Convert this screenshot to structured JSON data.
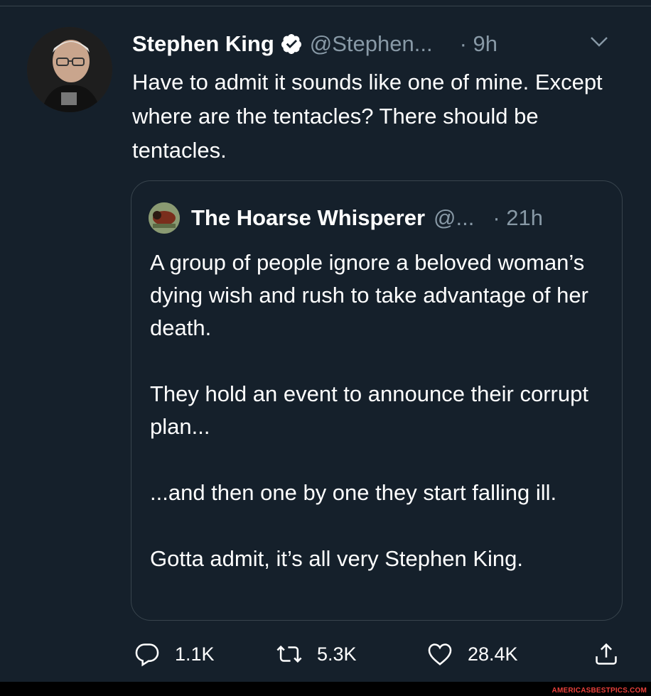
{
  "tweet": {
    "author_name": "Stephen King",
    "handle": "@Stephen...",
    "time": "· 9h",
    "text": "Have to admit it sounds like one of mine. Except where are the tentacles? There should be tentacles."
  },
  "quoted": {
    "author_name": "The Hoarse Whisperer",
    "handle": "@...",
    "time": "· 21h",
    "paragraphs": [
      "A group of people ignore a beloved woman’s dying wish and rush to take advantage of her death.",
      "They hold an event to announce their corrupt plan...",
      "...and then one by one they start falling ill.",
      "Gotta admit, it’s all very Stephen King."
    ]
  },
  "actions": {
    "replies": "1.1K",
    "retweets": "5.3K",
    "likes": "28.4K"
  },
  "watermark": "AMERICASBESTPICS.COM",
  "colors": {
    "background": "#15202b",
    "secondary_text": "#8899a6",
    "border": "#38444d",
    "verified": "#ffffff"
  }
}
